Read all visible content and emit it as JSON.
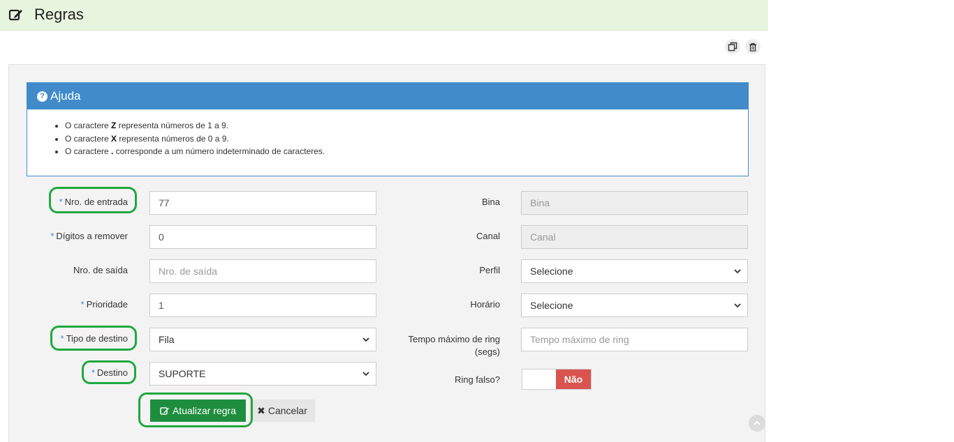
{
  "header": {
    "title": "Regras",
    "icon": "edit-icon"
  },
  "toolbar": {
    "duplicate_icon": "copy-icon",
    "delete_icon": "trash-icon"
  },
  "help": {
    "title": "Ajuda",
    "items": [
      {
        "pre": "O caractere ",
        "bold": "Z",
        "post": " representa números de 1 a 9."
      },
      {
        "pre": "O caractere ",
        "bold": "X",
        "post": " representa números de 0 a 9."
      },
      {
        "pre": "O caractere ",
        "bold": ".",
        "post": " corresponde a um número indeterminado de caracteres."
      }
    ]
  },
  "form": {
    "required_mark": "*",
    "nro_entrada": {
      "label": "Nro. de entrada",
      "value": "77"
    },
    "digitos_remover": {
      "label": "Dígitos a remover",
      "value": "0"
    },
    "nro_saida": {
      "label": "Nro. de saída",
      "placeholder": "Nro. de saída"
    },
    "prioridade": {
      "label": "Prioridade",
      "value": "1"
    },
    "tipo_destino": {
      "label": "Tipo de destino",
      "value": "Fila"
    },
    "destino": {
      "label": "Destino",
      "value": "SUPORTE"
    },
    "bina": {
      "label": "Bina",
      "placeholder": "Bina"
    },
    "canal": {
      "label": "Canal",
      "placeholder": "Canal"
    },
    "perfil": {
      "label": "Perfil",
      "value": "Selecione"
    },
    "horario": {
      "label": "Horário",
      "value": "Selecione"
    },
    "tempo_ring": {
      "label_line1": "Tempo máximo de ring",
      "label_line2": "(segs)",
      "placeholder": "Tempo máximo de ring"
    },
    "ring_falso": {
      "label": "Ring falso?",
      "value": "Não"
    }
  },
  "actions": {
    "update": "Atualizar regra",
    "cancel": "Cancelar"
  },
  "colors": {
    "header_bg": "#e8f5de",
    "help_blue": "#428bca",
    "update_green": "#1e8e3e",
    "toggle_red": "#d9534f",
    "highlight_ring": "#1fa83f"
  }
}
